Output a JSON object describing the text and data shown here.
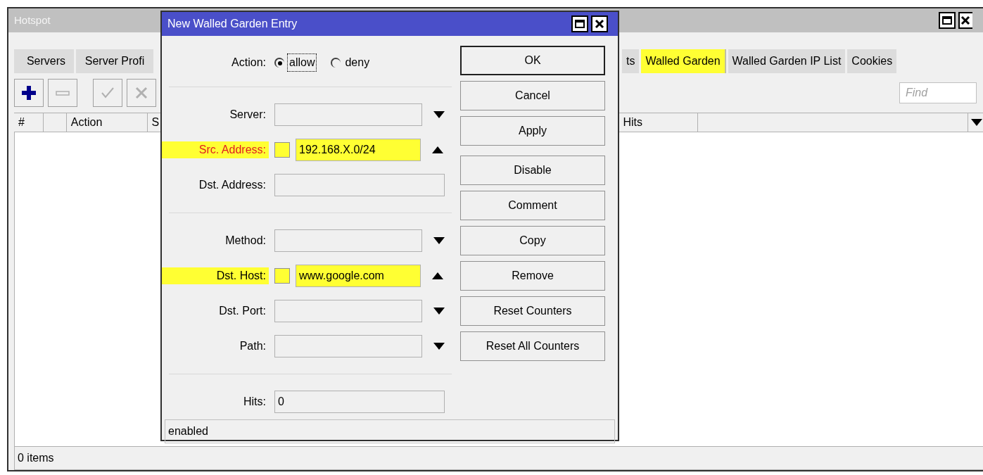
{
  "window": {
    "title": "Hotspot"
  },
  "tabs": [
    {
      "label": "Servers",
      "selected": false,
      "highlighted": false
    },
    {
      "label": "Server Profi",
      "selected": false,
      "highlighted": false
    },
    {
      "label": "ts",
      "selected": false,
      "highlighted": false
    },
    {
      "label": "Walled Garden",
      "selected": true,
      "highlighted": true
    },
    {
      "label": "Walled Garden IP List",
      "selected": false,
      "highlighted": false
    },
    {
      "label": "Cookies",
      "selected": false,
      "highlighted": false
    }
  ],
  "toolbar": [
    {
      "kind": "add",
      "disabled": false
    },
    {
      "kind": "remove",
      "disabled": true
    },
    {
      "kind": "enable",
      "disabled": true
    },
    {
      "kind": "disable",
      "disabled": true
    }
  ],
  "search": {
    "placeholder": "Find"
  },
  "table": {
    "columns": [
      "#",
      "",
      "Action",
      "S",
      "Hits",
      ""
    ]
  },
  "status_bar": "0 items",
  "dialog": {
    "title": "New Walled Garden Entry",
    "action": {
      "label": "Action:",
      "options": [
        {
          "label": "allow",
          "selected": true
        },
        {
          "label": "deny",
          "selected": false
        }
      ]
    },
    "fields": [
      {
        "kind": "separator"
      },
      {
        "kind": "select",
        "label": "Server:",
        "highlighted": false,
        "warning": false
      },
      {
        "kind": "negatable",
        "label": "Src. Address:",
        "value": "192.168.X.0/24",
        "checked": false,
        "highlighted": true,
        "warning": true
      },
      {
        "kind": "text",
        "label": "Dst. Address:",
        "highlighted": false,
        "warning": false
      },
      {
        "kind": "separator"
      },
      {
        "kind": "select",
        "label": "Method:",
        "highlighted": false,
        "warning": false
      },
      {
        "kind": "negatable",
        "label": "Dst. Host:",
        "value": "www.google.com",
        "checked": false,
        "highlighted": true,
        "warning": false
      },
      {
        "kind": "select",
        "label": "Dst. Port:",
        "highlighted": false,
        "warning": false
      },
      {
        "kind": "select",
        "label": "Path:",
        "highlighted": false,
        "warning": false
      },
      {
        "kind": "separator"
      },
      {
        "kind": "text",
        "label": "Hits:",
        "value": "0",
        "highlighted": false,
        "warning": false
      }
    ],
    "buttons": [
      {
        "label": "OK",
        "default": true
      },
      {
        "label": "Cancel",
        "default": false
      },
      {
        "label": "Apply",
        "default": false
      },
      {
        "label": "Disable",
        "default": false
      },
      {
        "label": "Comment",
        "default": false
      },
      {
        "label": "Copy",
        "default": false
      },
      {
        "label": "Remove",
        "default": false
      },
      {
        "label": "Reset Counters",
        "default": false
      },
      {
        "label": "Reset All Counters",
        "default": false
      }
    ],
    "status": "enabled"
  }
}
